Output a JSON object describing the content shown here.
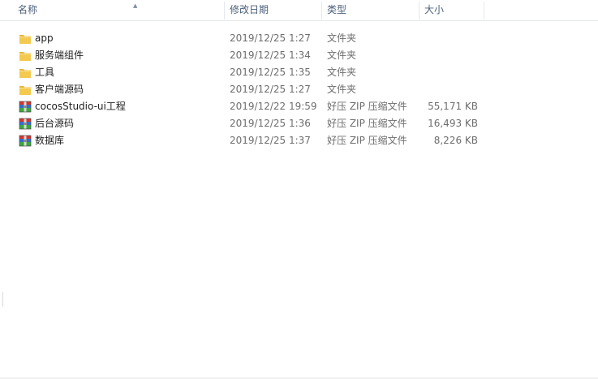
{
  "columns": {
    "name": "名称",
    "modified": "修改日期",
    "type": "类型",
    "size": "大小"
  },
  "files": [
    {
      "name": "app",
      "modified": "2019/12/25 1:27",
      "type": "文件夹",
      "size": "",
      "icon": "folder-icon"
    },
    {
      "name": "服务端组件",
      "modified": "2019/12/25 1:34",
      "type": "文件夹",
      "size": "",
      "icon": "folder-icon"
    },
    {
      "name": "工具",
      "modified": "2019/12/25 1:35",
      "type": "文件夹",
      "size": "",
      "icon": "folder-icon"
    },
    {
      "name": "客户端源码",
      "modified": "2019/12/25 1:27",
      "type": "文件夹",
      "size": "",
      "icon": "folder-icon"
    },
    {
      "name": "cocosStudio-ui工程",
      "modified": "2019/12/22 19:59",
      "type": "好压 ZIP 压缩文件",
      "size": "55,171 KB",
      "icon": "zip-archive-icon"
    },
    {
      "name": "后台源码",
      "modified": "2019/12/25 1:36",
      "type": "好压 ZIP 压缩文件",
      "size": "16,493 KB",
      "icon": "zip-archive-icon"
    },
    {
      "name": "数据库",
      "modified": "2019/12/25 1:37",
      "type": "好压 ZIP 压缩文件",
      "size": "8,226 KB",
      "icon": "zip-archive-icon"
    }
  ],
  "sort_icon": "sort-up-icon",
  "colors": {
    "header_text": "#4c607a",
    "folder": "#f3c94f",
    "zip_red": "#d9352b",
    "zip_blue": "#2f6fd1",
    "zip_green": "#3aa83a"
  }
}
